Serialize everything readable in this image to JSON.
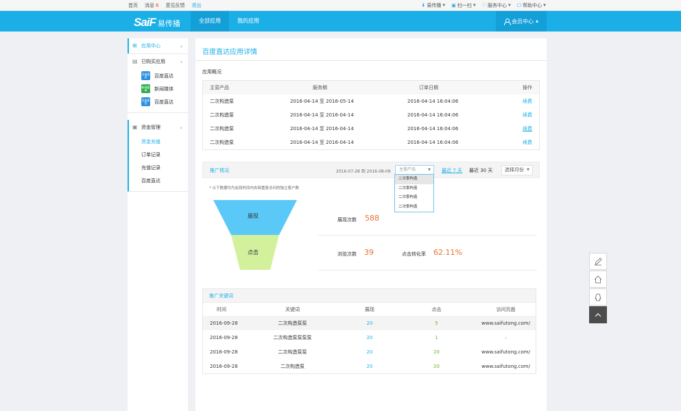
{
  "topbar": {
    "home": "首页",
    "messages": "消息",
    "messages_count": "6",
    "feedback": "意见反馈",
    "logout": "退出",
    "right_items": [
      {
        "icon": "download-icon",
        "label": "易传播"
      },
      {
        "icon": "qr-icon",
        "label": "扫一扫"
      },
      {
        "icon": "heart-icon",
        "label": "服务中心"
      },
      {
        "icon": "help-icon",
        "label": "帮助中心"
      }
    ]
  },
  "header": {
    "logo_mark": "SaiF",
    "logo_text": "易传播",
    "tabs": [
      "全部应用",
      "我的应用"
    ],
    "member": "会员中心"
  },
  "sidebar": {
    "app_center": "应用中心",
    "purchased": "已购买应用",
    "apps": [
      {
        "icon_text": "百度直达",
        "label": "百度直达",
        "color": "#2a8fe0"
      },
      {
        "icon_text": "新闻媒体",
        "label": "新闻媒体",
        "color": "#2eb04e"
      },
      {
        "icon_text": "百度直达",
        "label": "百度直达",
        "color": "#2a8fe0"
      }
    ],
    "funds": "资金管理",
    "sub_items": [
      "资金充值",
      "订单记录",
      "充值记录",
      "百度直达"
    ]
  },
  "main": {
    "title": "百度直达应用详情",
    "overview_label": "应用概况",
    "overview_table": {
      "headers": [
        "主营产品",
        "服务期",
        "订单日期",
        "操作"
      ],
      "rows": [
        [
          "二次构造泵",
          "2016-04-14 至 2016-05-14",
          "2016-04-14  16:04:06",
          "续费"
        ],
        [
          "二次构造泵",
          "2016-04-14 至 2016-04-14",
          "2016-04-14  16:04:06",
          "续费"
        ],
        [
          "二次构造泵",
          "2016-04-14 至 2016-04-14",
          "2016-04-14  16:04:06",
          "续费"
        ],
        [
          "二次构造泵",
          "2016-04-14 至 2016-04-14",
          "2016-04-14  16:04:06",
          "续费"
        ]
      ]
    },
    "promo": {
      "title": "推广情况",
      "date_range": "2016-07-28 到 2016-08-09",
      "product_placeholder": "主营产品",
      "last7": "最近 7 天",
      "last30": "最近 30 天",
      "month_select": "选择月份",
      "dropdown_options": [
        "二次泵构造",
        "二次泵构造",
        "二次泵构造",
        "二次泵构造"
      ],
      "note": "* 以下数据均为此段时间内去除重复访问的独立客户数",
      "funnel_top": "展现",
      "funnel_bottom": "点击",
      "impressions_label": "展现次数",
      "impressions_value": "588",
      "views_label": "浏览次数",
      "views_value": "39",
      "ctr_label": "点击转化率",
      "ctr_value": "62.11%"
    },
    "keywords": {
      "title": "推广关键词",
      "headers": [
        "时间",
        "关键词",
        "展现",
        "点击",
        "访问页面"
      ],
      "rows": [
        [
          "2016-09-28",
          "二次构造泵泵",
          "20",
          "5",
          "www.saifutong.com/"
        ],
        [
          "2016-09-28",
          "二次构造泵泵泵泵",
          "20",
          "1",
          "–"
        ],
        [
          "2016-09-28",
          "二次构造泵泵",
          "20",
          "20",
          "www.saifutong.com/"
        ],
        [
          "2016-09-28",
          "二次构造泵",
          "20",
          "20",
          "www.saifutong.com/"
        ]
      ]
    }
  },
  "float_toolbar": [
    "edit-icon",
    "home-icon",
    "qq-icon",
    "back-to-top-icon"
  ]
}
